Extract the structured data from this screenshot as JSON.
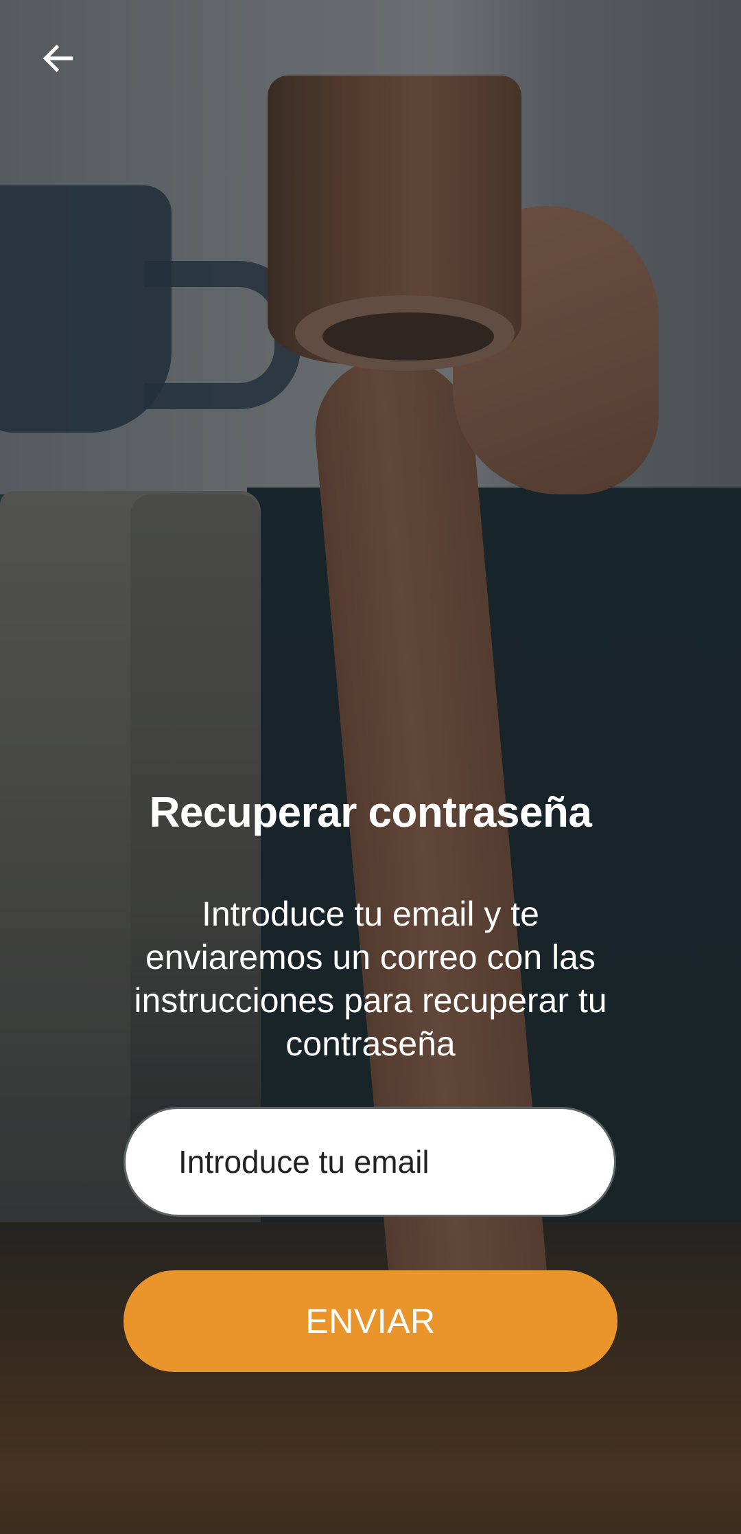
{
  "header": {
    "back_icon": "arrow-left-icon"
  },
  "title": "Recuperar contraseña",
  "description": "Introduce tu email y te enviaremos un correo con las instrucciones para recuperar tu contraseña",
  "email_input": {
    "placeholder": "Introduce tu email",
    "value": ""
  },
  "send_button": {
    "label": "ENVIAR"
  },
  "colors": {
    "accent": "#ea942c",
    "text_on_dark": "#ffffff",
    "input_background": "#ffffff"
  }
}
